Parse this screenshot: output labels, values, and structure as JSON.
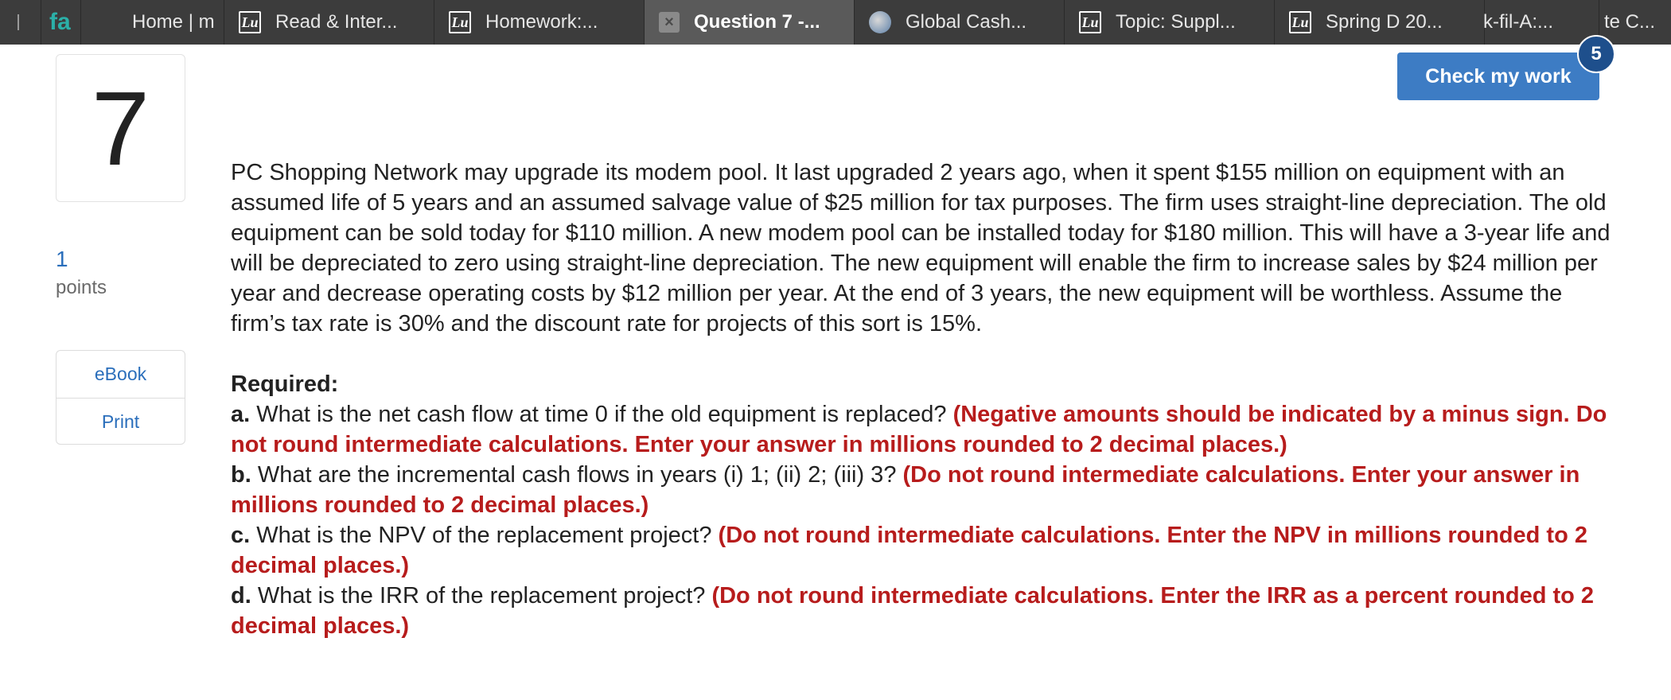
{
  "browser": {
    "tabs": [
      {
        "label": "",
        "icon": "circle-icon"
      },
      {
        "label": "fa",
        "icon": "fa-logo-icon"
      },
      {
        "label": "Home | m",
        "icon": "microsoft-icon"
      },
      {
        "label": "Read & Inter...",
        "icon": "lu-icon"
      },
      {
        "label": "Homework:...",
        "icon": "lu-icon"
      },
      {
        "label": "Question 7 -...",
        "icon": "close-icon",
        "active": true
      },
      {
        "label": "Global Cash...",
        "icon": "globe-icon"
      },
      {
        "label": "Topic: Suppl...",
        "icon": "lu-icon"
      },
      {
        "label": "Spring D 20...",
        "icon": "lu-icon"
      },
      {
        "label": "k-fil-A:...",
        "icon": ""
      },
      {
        "label": "te C...",
        "icon": ""
      }
    ]
  },
  "question": {
    "number": "7",
    "points_value": "1",
    "points_label": "points",
    "tools": {
      "ebook": "eBook",
      "print": "Print"
    },
    "check_button": "Check my work",
    "check_badge": "5",
    "prompt": "PC Shopping Network may upgrade its modem pool. It last upgraded 2 years ago, when it spent $155 million on equipment with an assumed life of 5 years and an assumed salvage value of $25 million for tax purposes. The firm uses straight-line depreciation. The old equipment can be sold today for $110 million. A new modem pool can be installed today for $180 million. This will have a 3-year life and will be depreciated to zero using straight-line depreciation. The new equipment will enable the firm to increase sales by $24 million per year and decrease operating costs by $12 million per year. At the end of 3 years, the new equipment will be worthless. Assume the firm’s tax rate is 30% and the discount rate for projects of this sort is 15%.",
    "required_label": "Required:",
    "parts": [
      {
        "letter": "a.",
        "text": "What is the net cash flow at time 0 if the old equipment is replaced?",
        "note": "(Negative amounts should be indicated by a minus sign. Do not round intermediate calculations. Enter your answer in millions rounded to 2 decimal places.)"
      },
      {
        "letter": "b.",
        "text": "What are the incremental cash flows in years (i) 1; (ii) 2; (iii) 3?",
        "note": "(Do not round intermediate calculations. Enter your answer in millions rounded to 2 decimal places.)"
      },
      {
        "letter": "c.",
        "text": "What is the NPV of the replacement project?",
        "note": "(Do not round intermediate calculations. Enter the NPV in millions rounded to 2 decimal places.)"
      },
      {
        "letter": "d.",
        "text": "What is the IRR of the replacement project?",
        "note": "(Do not round intermediate calculations. Enter the IRR as a percent rounded to 2 decimal places.)"
      }
    ]
  },
  "colors": {
    "accent_blue": "#3d7cc4",
    "badge_blue": "#1e4f8c",
    "link_blue": "#2a6ebb",
    "note_red": "#b71c1c",
    "tabbar_bg": "#3c3c3c"
  }
}
